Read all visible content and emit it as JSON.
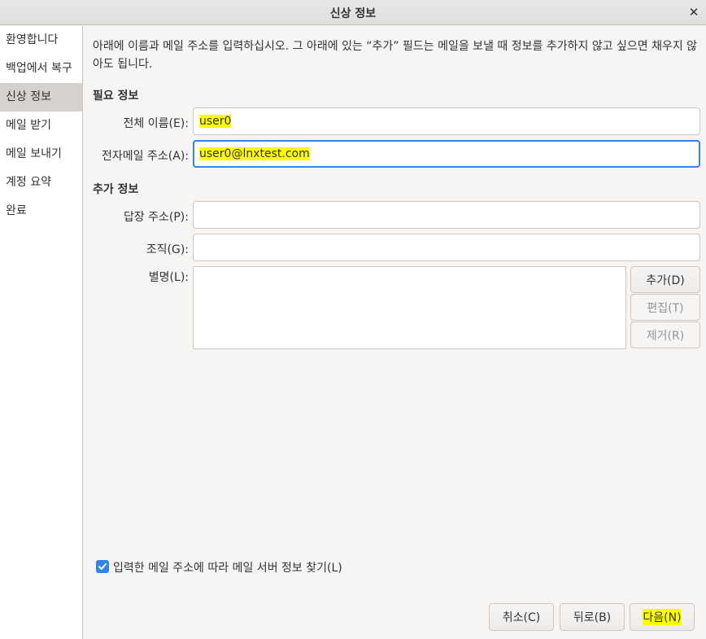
{
  "window": {
    "title": "신상 정보",
    "close_glyph": "✕"
  },
  "sidebar": {
    "items": [
      {
        "label": "환영합니다"
      },
      {
        "label": "백업에서 복구"
      },
      {
        "label": "신상 정보"
      },
      {
        "label": "메일 받기"
      },
      {
        "label": "메일 보내기"
      },
      {
        "label": "계정 요약"
      },
      {
        "label": "완료"
      }
    ],
    "selected_index": 2
  },
  "intro_text": "아래에 이름과 메일 주소를 입력하십시오. 그 아래에 있는 “추가” 필드는 메일을 보낼 때 정보를 추가하지 않고 싶으면 채우지 않아도 됩니다.",
  "required": {
    "heading": "필요 정보",
    "fullname": {
      "label": "전체 이름(E):",
      "value": "user0"
    },
    "email": {
      "label": "전자메일 주소(A):",
      "value": "user0@lnxtest.com"
    }
  },
  "optional": {
    "heading": "추가 정보",
    "reply_to": {
      "label": "답장 주소(P):",
      "value": ""
    },
    "organization": {
      "label": "조직(G):",
      "value": ""
    },
    "aliases": {
      "label": "별명(L):"
    },
    "add_label": "추가(D)",
    "edit_label": "편집(T)",
    "remove_label": "제거(R)"
  },
  "lookup": {
    "label": "입력한 메일 주소에 따라 메일 서버 정보 찾기(L)",
    "checked": true
  },
  "footer": {
    "cancel_label": "취소(C)",
    "back_label": "뒤로(B)",
    "next_label": "다음(N)"
  },
  "colors": {
    "accent": "#3584e4",
    "highlight": "#fdff00",
    "sidebar_selected": "#d6d1cd"
  }
}
